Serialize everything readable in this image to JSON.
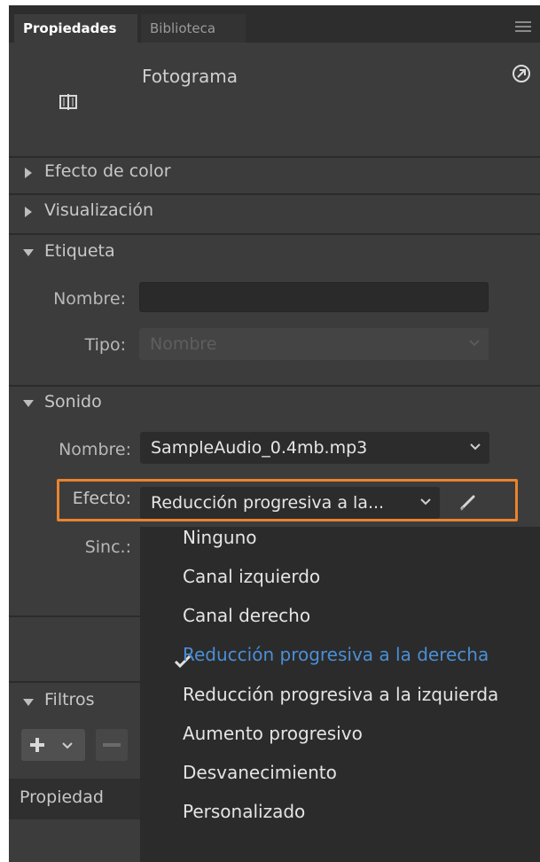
{
  "tabs": [
    {
      "label": "Propiedades",
      "active": true
    },
    {
      "label": "Biblioteca",
      "active": false
    }
  ],
  "header": {
    "title": "Fotograma",
    "icon": "frame-icon"
  },
  "sections": {
    "color_effect": "Efecto de color",
    "display": "Visualización",
    "label": "Etiqueta",
    "sound": "Sonido",
    "filters": "Filtros"
  },
  "label_section": {
    "name_label": "Nombre:",
    "name_value": "",
    "type_label": "Tipo:",
    "type_value": "Nombre"
  },
  "sound_section": {
    "name_label": "Nombre:",
    "name_value": "SampleAudio_0.4mb.mp3",
    "effect_label": "Efecto:",
    "effect_value": "Reducción progresiva a la...",
    "sync_label": "Sinc.:"
  },
  "effect_options": [
    "Ninguno",
    "Canal izquierdo",
    "Canal derecho",
    "Reducción progresiva a la derecha",
    "Reducción progresiva a la izquierda",
    "Aumento progresivo",
    "Desvanecimiento",
    "Personalizado"
  ],
  "selected_effect_index": 3,
  "filters_table": {
    "column_header": "Propiedad"
  },
  "colors": {
    "panel_bg": "#3c3c3c",
    "highlight": "#e8832e",
    "selected_text": "#4b8fd6"
  }
}
